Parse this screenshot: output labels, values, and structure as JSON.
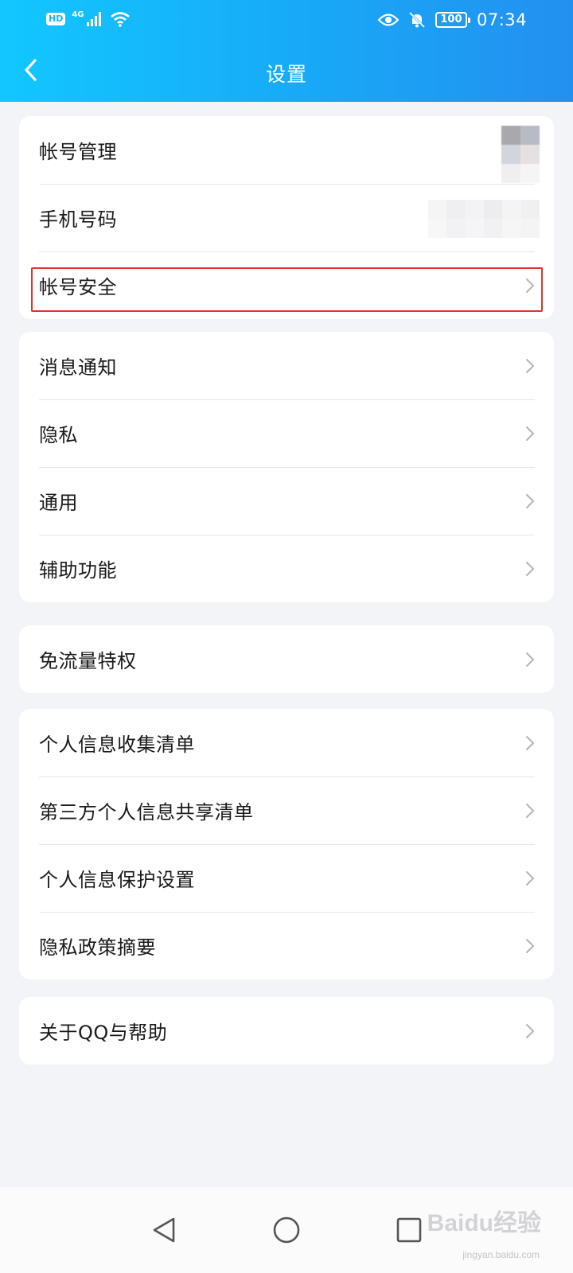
{
  "status_bar": {
    "hd_label": "HD",
    "network_type": "4G",
    "battery_level": "100",
    "time": "07:34"
  },
  "header": {
    "title": "设置"
  },
  "groups": [
    {
      "items": [
        {
          "label": "帐号管理",
          "trailing": "avatar"
        },
        {
          "label": "手机号码",
          "trailing": "hidden-value"
        },
        {
          "label": "帐号安全",
          "trailing": "chevron",
          "highlighted": true
        }
      ]
    },
    {
      "items": [
        {
          "label": "消息通知"
        },
        {
          "label": "隐私"
        },
        {
          "label": "通用"
        },
        {
          "label": "辅助功能"
        }
      ]
    },
    {
      "items": [
        {
          "label": "免流量特权"
        }
      ]
    },
    {
      "items": [
        {
          "label": "个人信息收集清单"
        },
        {
          "label": "第三方个人信息共享清单"
        },
        {
          "label": "个人信息保护设置"
        },
        {
          "label": "隐私政策摘要"
        }
      ]
    },
    {
      "items": [
        {
          "label": "关于QQ与帮助"
        }
      ]
    }
  ],
  "watermark": {
    "logo": "Baidu经验",
    "url": "jingyan.baidu.com"
  },
  "colors": {
    "header_start": "#12c7ff",
    "header_end": "#2390f0",
    "highlight": "#d9362c",
    "background": "#f2f4f8"
  }
}
